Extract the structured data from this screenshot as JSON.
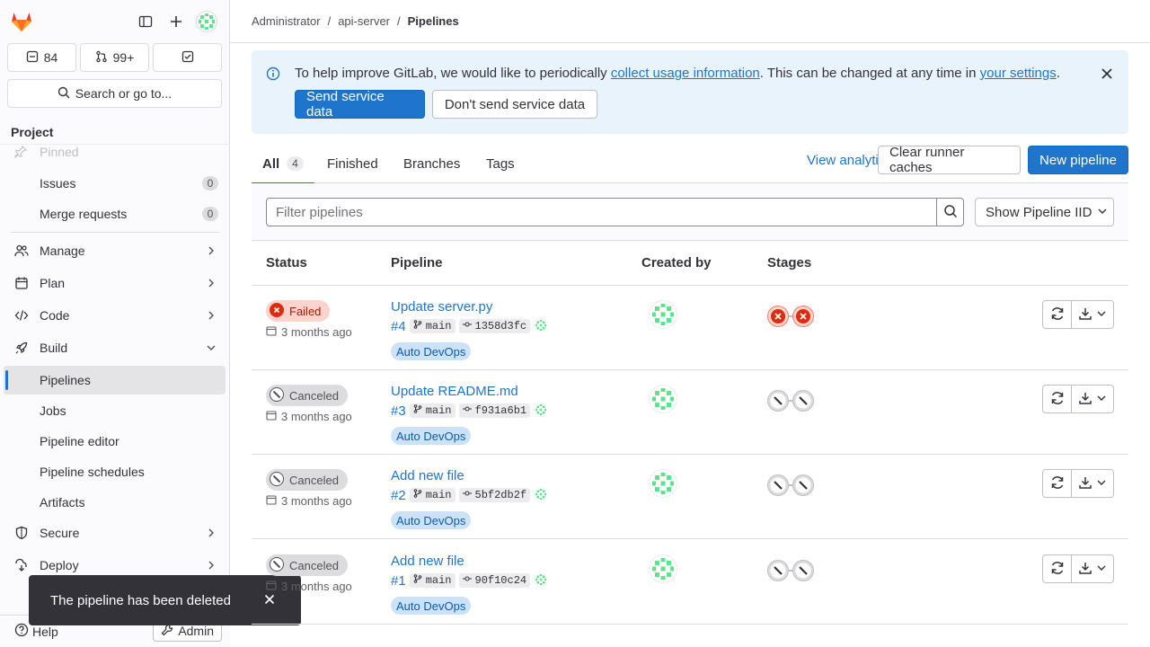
{
  "sidebar": {
    "counts": {
      "issues": "84",
      "merge_requests": "99+"
    },
    "search_label": "Search or go to...",
    "section_title": "Project",
    "pinned_label": "Pinned",
    "items": [
      {
        "label": "Issues",
        "badge": "0"
      },
      {
        "label": "Merge requests",
        "badge": "0"
      },
      {
        "label": "Manage"
      },
      {
        "label": "Plan"
      },
      {
        "label": "Code"
      },
      {
        "label": "Build"
      },
      {
        "label": "Pipelines"
      },
      {
        "label": "Jobs"
      },
      {
        "label": "Pipeline editor"
      },
      {
        "label": "Pipeline schedules"
      },
      {
        "label": "Artifacts"
      },
      {
        "label": "Secure"
      },
      {
        "label": "Deploy"
      }
    ],
    "help_label": "Help",
    "admin_label": "Admin"
  },
  "toast": {
    "message": "The pipeline has been deleted"
  },
  "breadcrumb": {
    "items": [
      "Administrator",
      "api-server"
    ],
    "current": "Pipelines"
  },
  "alert": {
    "text_before": "To help improve GitLab, we would like to periodically ",
    "link1": "collect usage information",
    "text_mid": ". This can be changed at any time in ",
    "link2": "your settings",
    "text_after": ".",
    "send_label": "Send service data",
    "dont_send_label": "Don't send service data"
  },
  "tabs": [
    {
      "label": "All",
      "count": "4"
    },
    {
      "label": "Finished"
    },
    {
      "label": "Branches"
    },
    {
      "label": "Tags"
    }
  ],
  "actions": {
    "view_analytics": "View analytics",
    "clear_caches": "Clear runner caches",
    "new_pipeline": "New pipeline"
  },
  "filter": {
    "placeholder": "Filter pipelines",
    "select_label": "Show Pipeline IID"
  },
  "table": {
    "headers": [
      "Status",
      "Pipeline",
      "Created by",
      "Stages"
    ],
    "rows": [
      {
        "status": "Failed",
        "time": "3 months ago",
        "title": "Update server.py",
        "id": "#4",
        "branch": "main",
        "sha": "1358d3fc",
        "tag": "Auto DevOps"
      },
      {
        "status": "Canceled",
        "time": "3 months ago",
        "title": "Update README.md",
        "id": "#3",
        "branch": "main",
        "sha": "f931a6b1",
        "tag": "Auto DevOps"
      },
      {
        "status": "Canceled",
        "time": "3 months ago",
        "title": "Add new file",
        "id": "#2",
        "branch": "main",
        "sha": "5bf2db2f",
        "tag": "Auto DevOps"
      },
      {
        "status": "Canceled",
        "time": "3 months ago",
        "title": "Add new file",
        "id": "#1",
        "branch": "main",
        "sha": "90f10c24",
        "tag": "Auto DevOps"
      }
    ]
  },
  "colors": {
    "primary": "#1f75cb",
    "failed": "#dd2b0e",
    "canceled": "#535158",
    "avatar": "#5be58b"
  }
}
